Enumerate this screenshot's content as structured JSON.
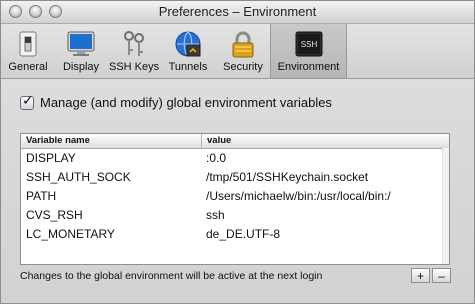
{
  "window": {
    "title": "Preferences – Environment"
  },
  "toolbar": {
    "items": [
      {
        "label": "General",
        "icon": "general-switch-icon"
      },
      {
        "label": "Display",
        "icon": "display-monitor-icon"
      },
      {
        "label": "SSH Keys",
        "icon": "ssh-keys-icon"
      },
      {
        "label": "Tunnels",
        "icon": "tunnels-globe-icon"
      },
      {
        "label": "Security",
        "icon": "lock-icon"
      },
      {
        "label": "Environment",
        "icon": "terminal-ssh-icon",
        "selected": true
      }
    ]
  },
  "env": {
    "checkbox_label": "Manage (and modify) global environment variables",
    "checkbox_checked": true,
    "table": {
      "columns": [
        "Variable name",
        "value"
      ],
      "rows": [
        [
          "DISPLAY",
          ":0.0"
        ],
        [
          "SSH_AUTH_SOCK",
          "/tmp/501/SSHKeychain.socket"
        ],
        [
          "PATH",
          "/Users/michaelw/bin:/usr/local/bin:/"
        ],
        [
          "CVS_RSH",
          "ssh"
        ],
        [
          "LC_MONETARY",
          "de_DE.UTF-8"
        ]
      ]
    },
    "footer_note": "Changes to the global environment will be active at the next login",
    "add_label": "+",
    "remove_label": "–"
  },
  "icon_text": {
    "terminal": "SSH"
  }
}
